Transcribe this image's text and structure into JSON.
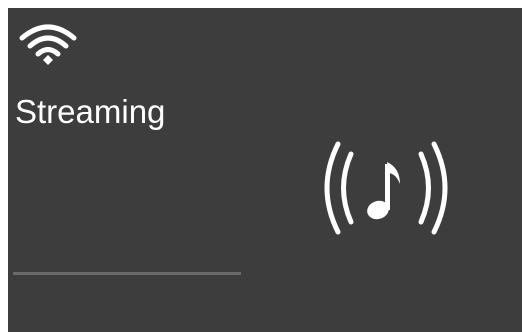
{
  "status": {
    "wifi_icon": "wifi-icon",
    "wifi_strength": "full"
  },
  "main": {
    "title": "Streaming",
    "stream_icon": "music-stream-icon",
    "progress": 1.0
  },
  "colors": {
    "background": "#3d3d3d",
    "foreground": "#ffffff",
    "progress": "#6a6a6a"
  }
}
